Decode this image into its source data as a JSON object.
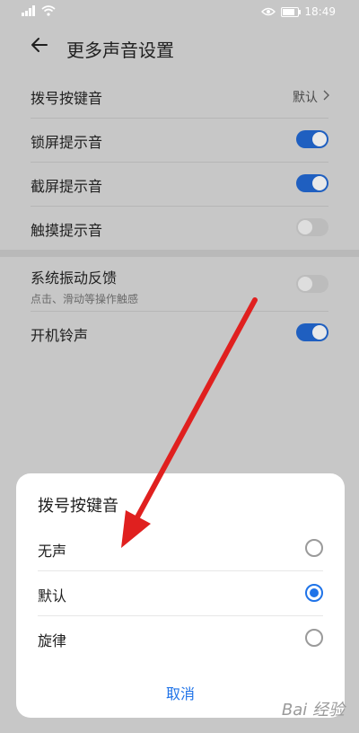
{
  "status": {
    "time": "18:49",
    "battery_level": 0.8
  },
  "header": {
    "title": "更多声音设置"
  },
  "settings": {
    "dial_tone": {
      "label": "拨号按键音",
      "value": "默认"
    },
    "lock_sound": {
      "label": "锁屏提示音",
      "on": true
    },
    "screenshot_sound": {
      "label": "截屏提示音",
      "on": true
    },
    "touch_sound": {
      "label": "触摸提示音",
      "on": false
    },
    "vibration": {
      "label": "系统振动反馈",
      "sublabel": "点击、滑动等操作触感",
      "on": false
    },
    "boot_sound": {
      "label": "开机铃声",
      "on": true
    }
  },
  "dialog": {
    "title": "拨号按键音",
    "options": [
      {
        "label": "无声",
        "checked": false
      },
      {
        "label": "默认",
        "checked": true
      },
      {
        "label": "旋律",
        "checked": false
      }
    ],
    "cancel": "取消"
  },
  "watermark": {
    "text": "Bai 经验"
  },
  "colors": {
    "accent": "#1f73e8",
    "toggle_on": "#1f5fc0",
    "overlay_bg": "#c7c7c7",
    "arrow": "#e0201f"
  },
  "icons": {
    "back": "back-arrow-icon",
    "chevron": "chevron-right-icon",
    "signal": "signal-icon",
    "wifi": "wifi-icon",
    "eye": "eye-comfort-icon",
    "battery": "battery-icon"
  }
}
